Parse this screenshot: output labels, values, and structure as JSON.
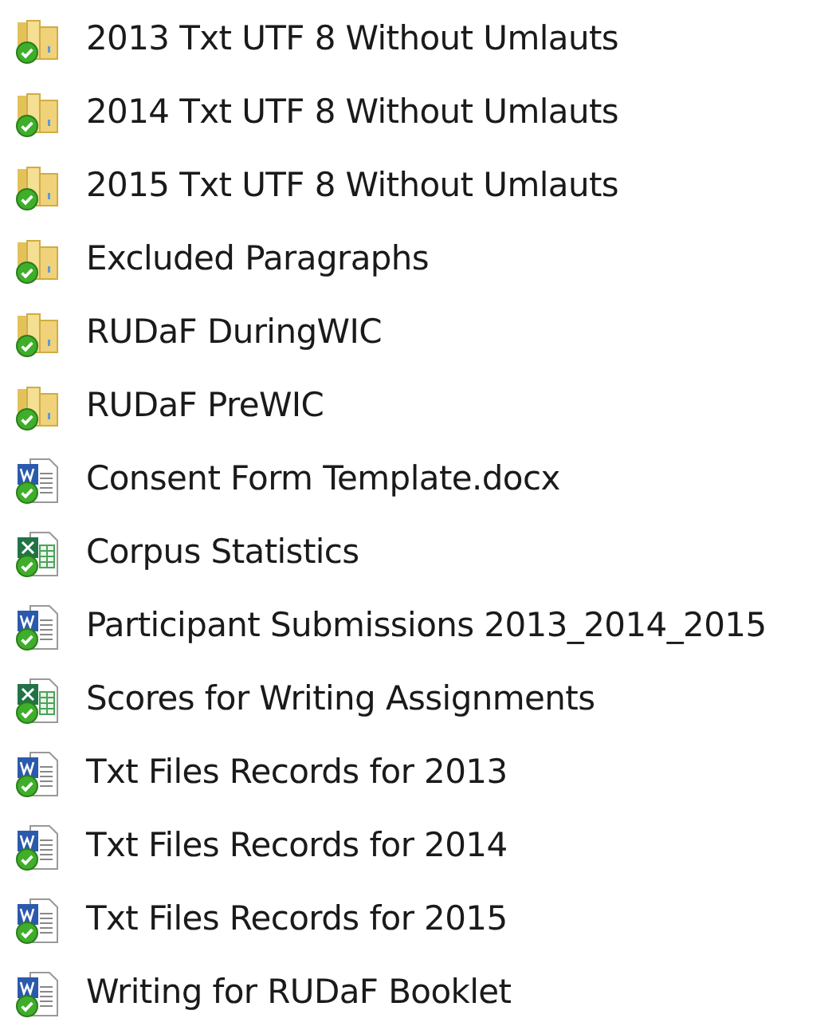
{
  "files": [
    {
      "name": "2013 Txt UTF 8 Without Umlauts",
      "kind": "folder"
    },
    {
      "name": "2014 Txt UTF 8 Without Umlauts",
      "kind": "folder"
    },
    {
      "name": "2015 Txt UTF 8 Without Umlauts",
      "kind": "folder"
    },
    {
      "name": "Excluded Paragraphs",
      "kind": "folder"
    },
    {
      "name": "RUDaF DuringWIC",
      "kind": "folder"
    },
    {
      "name": "RUDaF PreWIC",
      "kind": "folder"
    },
    {
      "name": "Consent Form Template.docx",
      "kind": "document"
    },
    {
      "name": "Corpus Statistics",
      "kind": "spreadsheet"
    },
    {
      "name": "Participant Submissions 2013_2014_2015",
      "kind": "document"
    },
    {
      "name": "Scores for Writing Assignments",
      "kind": "spreadsheet"
    },
    {
      "name": "Txt Files Records for 2013",
      "kind": "document"
    },
    {
      "name": "Txt Files Records for 2014",
      "kind": "document"
    },
    {
      "name": "Txt Files Records for 2015",
      "kind": "document"
    },
    {
      "name": "Writing for RUDaF Booklet",
      "kind": "document"
    }
  ]
}
